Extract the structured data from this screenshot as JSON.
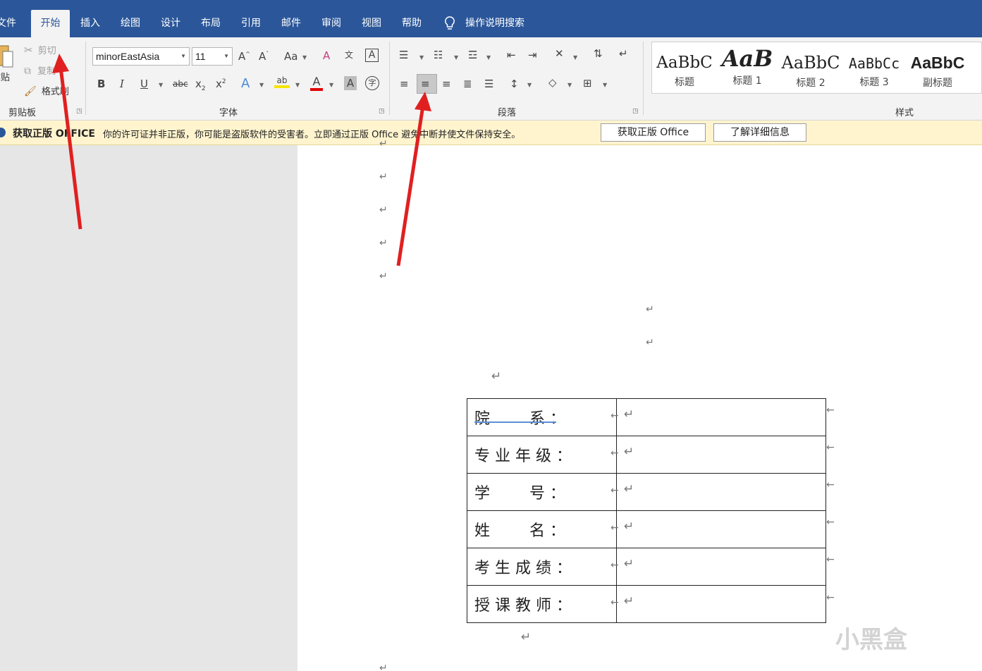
{
  "tabs": [
    {
      "label": "文件"
    },
    {
      "label": "开始"
    },
    {
      "label": "插入"
    },
    {
      "label": "绘图"
    },
    {
      "label": "设计"
    },
    {
      "label": "布局"
    },
    {
      "label": "引用"
    },
    {
      "label": "邮件"
    },
    {
      "label": "审阅"
    },
    {
      "label": "视图"
    },
    {
      "label": "帮助"
    }
  ],
  "tell_me": "操作说明搜索",
  "clipboard": {
    "paste_label": "粘贴",
    "cut_label": "剪切",
    "copy_label": "复制",
    "format_painter_label": "格式刷",
    "group_label": "剪贴板"
  },
  "font": {
    "font_name": "minorEastAsia",
    "font_size": "11",
    "group_label": "字体"
  },
  "paragraph": {
    "group_label": "段落"
  },
  "styles": {
    "group_label": "样式",
    "items": [
      {
        "sample": "AaBbC",
        "name": "标题"
      },
      {
        "sample": "AaB",
        "name": "标题 1"
      },
      {
        "sample": "AaBbC",
        "name": "标题 2"
      },
      {
        "sample": "AaBbCc",
        "name": "标题 3"
      },
      {
        "sample": "AaBbC",
        "name": "副标题"
      }
    ]
  },
  "message_bar": {
    "title": "获取正版 OFFICE",
    "text": "你的许可证并非正版，你可能是盗版软件的受害者。立即通过正版 Office 避免中断并使文件保持安全。",
    "get_button": "获取正版 Office",
    "learn_button": "了解详细信息"
  },
  "document": {
    "paragraph_mark": "↵",
    "table_rows": [
      {
        "label": "院        系 ："
      },
      {
        "label": "专 业 年 级 ："
      },
      {
        "label": "学        号 ："
      },
      {
        "label": "姓        名 ："
      },
      {
        "label": "考 生 成 绩 ："
      },
      {
        "label": "授 课 教 师 ："
      }
    ]
  },
  "watermark": "小黑盒",
  "colors": {
    "title_bar": "#2b579a",
    "ribbon_bg": "#f3f3f3",
    "message_bar_bg": "#fff4ce",
    "annotation_arrow": "#e02020"
  },
  "icons": {
    "tell_me": "lightbulb-icon",
    "cut": "scissors-icon",
    "copy": "copy-icon",
    "format_painter": "paintbrush-icon"
  }
}
